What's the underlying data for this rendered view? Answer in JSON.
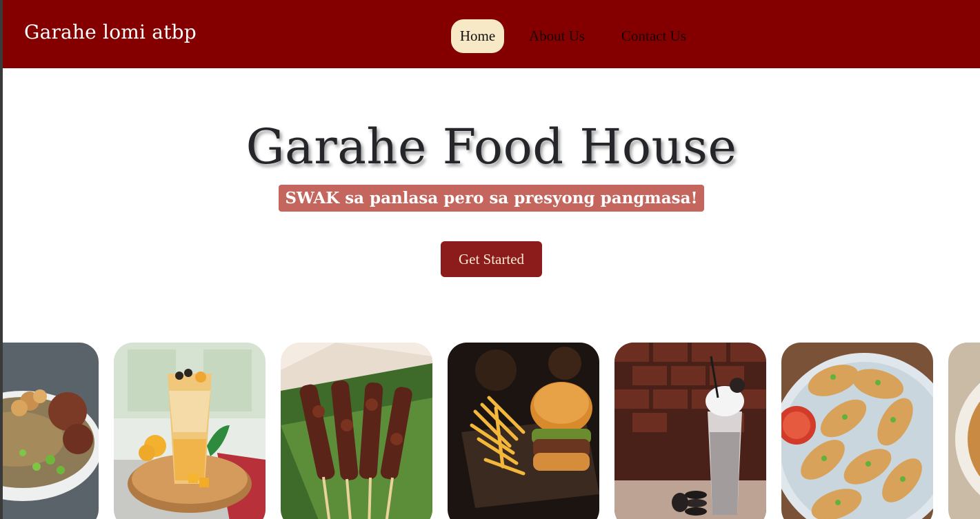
{
  "navbar": {
    "brand": "Garahe lomi atbp",
    "items": [
      {
        "label": "Home",
        "active": true
      },
      {
        "label": "About Us",
        "active": false
      },
      {
        "label": "Contact Us",
        "active": false
      }
    ]
  },
  "hero": {
    "title": "Garahe Food House",
    "tagline": "SWAK sa panlasa pero sa presyong pangmasa!",
    "cta_label": "Get Started"
  },
  "carousel": {
    "items": [
      {
        "name": "lomi-bowl-image"
      },
      {
        "name": "mango-shake-image"
      },
      {
        "name": "pork-barbecue-image"
      },
      {
        "name": "burger-fries-image"
      },
      {
        "name": "cookies-cream-shake-image"
      },
      {
        "name": "dumplings-image"
      },
      {
        "name": "soup-bowl-image"
      }
    ]
  },
  "colors": {
    "navbar_bg": "#840000",
    "active_tab_bg": "#f8e9c6",
    "tagline_bg": "#c4655e",
    "cta_bg": "#8c1c1c"
  }
}
